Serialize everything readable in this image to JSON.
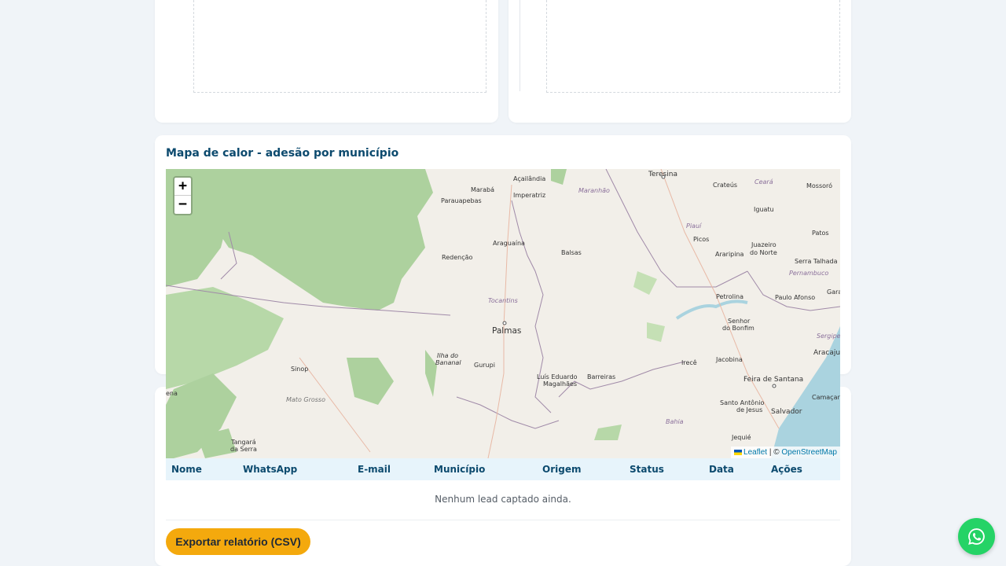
{
  "map_section": {
    "title": "Mapa de calor - adesão por município",
    "zoom_in": "+",
    "zoom_out": "−",
    "attribution": {
      "leaflet": "Leaflet",
      "separator": " | © ",
      "osm": "OpenStreetMap"
    },
    "labels": {
      "teresina": "Teresina",
      "acailandia": "Açailândia",
      "maraba": "Marabá",
      "imperatriz": "Imperatriz",
      "maranhao": "Maranhão",
      "parauapebas": "Parauapebas",
      "crateus": "Crateús",
      "ceara": "Ceará",
      "mossoro": "Mossoró",
      "iguatu": "Iguatu",
      "piaui": "Piauí",
      "patos": "Patos",
      "araguaina": "Araguaína",
      "balsas": "Balsas",
      "picos": "Picos",
      "araripina": "Araripina",
      "juazeiro_do_norte_1": "Juazeiro",
      "juazeiro_do_norte_2": "do Norte",
      "serra_talhada": "Serra Talhada",
      "redencao": "Redenção",
      "pernambuco": "Pernambuco",
      "tocantins": "Tocantins",
      "petrolina": "Petrolina",
      "paulo_afonso": "Paulo Afonso",
      "gara": "Gara",
      "palmas": "Palmas",
      "senhor_do_bonfim_1": "Senhor",
      "senhor_do_bonfim_2": "do Bonfim",
      "sergipe": "Sergipe",
      "aracaju": "Aracaju",
      "ilha_bananal_1": "Ilha do",
      "ilha_bananal_2": "Bananal",
      "gurupi": "Gurupi",
      "irece": "Irecê",
      "jacobina": "Jacobina",
      "sinop": "Sinop",
      "luis_eduardo_1": "Luís Eduardo",
      "luis_eduardo_2": "Magalhães",
      "barreiras": "Barreiras",
      "feira": "Feira de Santana",
      "jena": "ena",
      "mato_grosso": "Mato Grosso",
      "santo_antonio_1": "Santo Antônio",
      "santo_antonio_2": "de Jesus",
      "camacari": "Camaçari",
      "salvador": "Salvador",
      "bahia": "Bahia",
      "tangara_1": "Tangará",
      "tangara_2": "da Serra",
      "jequie": "Jequié"
    }
  },
  "table": {
    "headers": [
      "Nome",
      "WhatsApp",
      "E-mail",
      "Município",
      "Origem",
      "Status",
      "Data",
      "Ações"
    ],
    "empty_message": "Nenhum lead captado ainda."
  },
  "actions": {
    "export_label": "Exportar relatório (CSV)"
  },
  "colors": {
    "accent": "#0c4a6e",
    "button": "#f4a90d",
    "whatsapp": "#25d366"
  }
}
